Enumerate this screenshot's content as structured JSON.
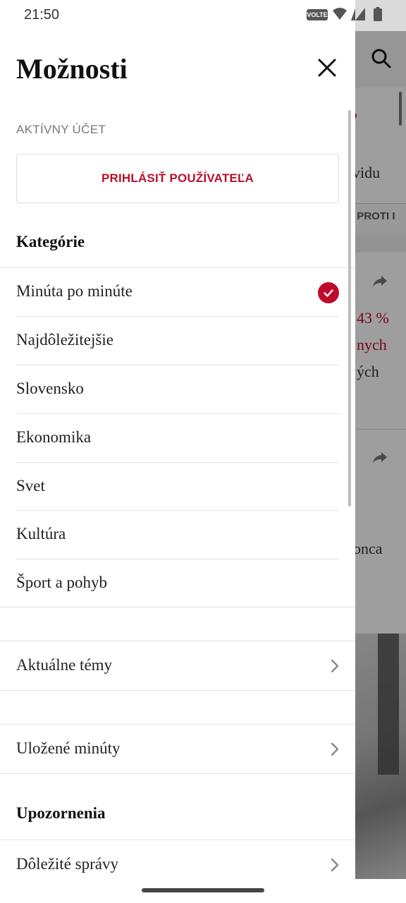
{
  "status_bar": {
    "time": "21:50",
    "volte": "VOLTE"
  },
  "background": {
    "texts": [
      "vidu",
      "IE PROTI I",
      "43 %",
      "nych",
      "ých",
      "konca"
    ]
  },
  "drawer": {
    "title": "Možnosti",
    "account_caption": "AKTÍVNY ÚČET",
    "login_label": "PRIHLÁSIŤ POUŽÍVATEĽA",
    "categories_heading": "Kategórie",
    "categories": [
      {
        "label": "Minúta po minúte",
        "selected": true
      },
      {
        "label": "Najdôležitejšie",
        "selected": false
      },
      {
        "label": "Slovensko",
        "selected": false
      },
      {
        "label": "Ekonomika",
        "selected": false
      },
      {
        "label": "Svet",
        "selected": false
      },
      {
        "label": "Kultúra",
        "selected": false
      },
      {
        "label": "Šport a pohyb",
        "selected": false
      }
    ],
    "topics_label": "Aktuálne témy",
    "saved_label": "Uložené minúty",
    "notifications_heading": "Upozornenia",
    "notifications_item": "Dôležité správy"
  },
  "colors": {
    "accent": "#c00a2c"
  }
}
